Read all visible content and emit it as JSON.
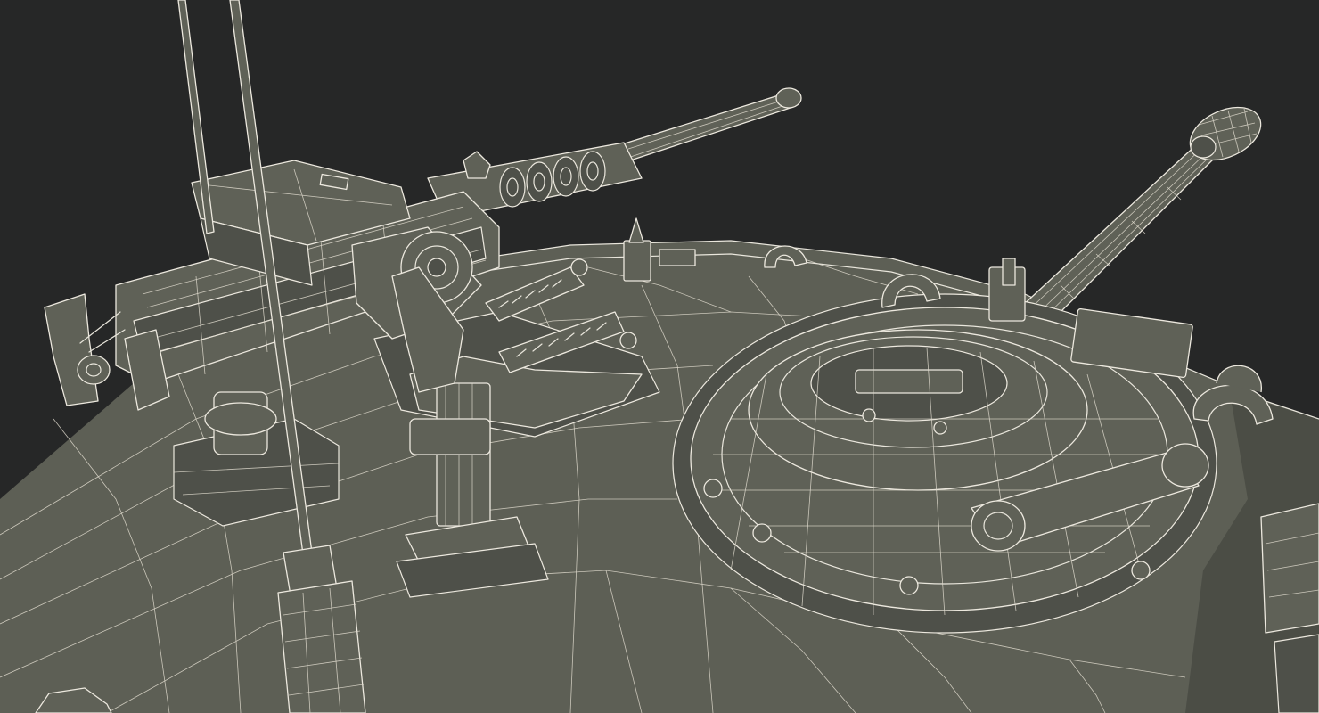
{
  "scene": {
    "background_color": "#262727",
    "model_fill_color": "#5d5f55",
    "wireframe_color": "#e9e6dc"
  }
}
